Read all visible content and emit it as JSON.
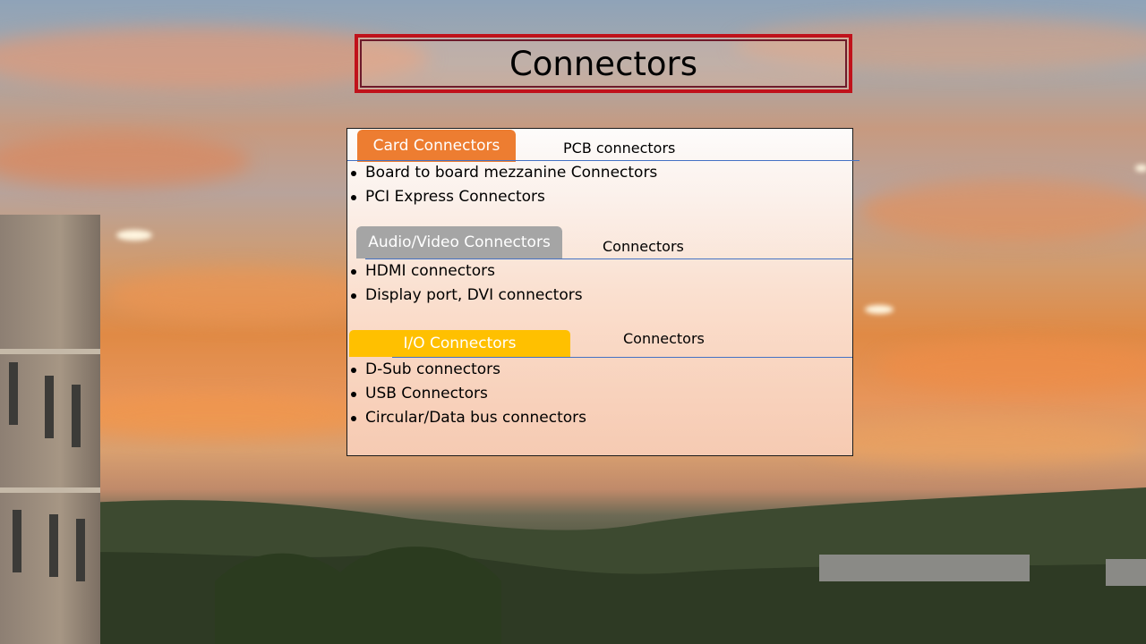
{
  "slide": {
    "title": "Connectors",
    "sections": [
      {
        "tab_label": "Card Connectors",
        "subtitle": "PCB connectors",
        "tab_color": "#ed7d31",
        "items": [
          "Board to board mezzanine Connectors",
          "PCI Express Connectors"
        ]
      },
      {
        "tab_label": "Audio/Video Connectors",
        "subtitle": "Connectors",
        "tab_color": "#a5a5a5",
        "items": [
          "HDMI connectors",
          "Display port, DVI connectors"
        ]
      },
      {
        "tab_label": "I/O Connectors",
        "subtitle": "Connectors",
        "tab_color": "#ffc000",
        "items": [
          "D-Sub connectors",
          "USB Connectors",
          "Circular/Data bus connectors"
        ]
      }
    ],
    "colors": {
      "title_border": "#c0121b",
      "divider_line": "#4472c4"
    },
    "background": "sunset-photo"
  }
}
